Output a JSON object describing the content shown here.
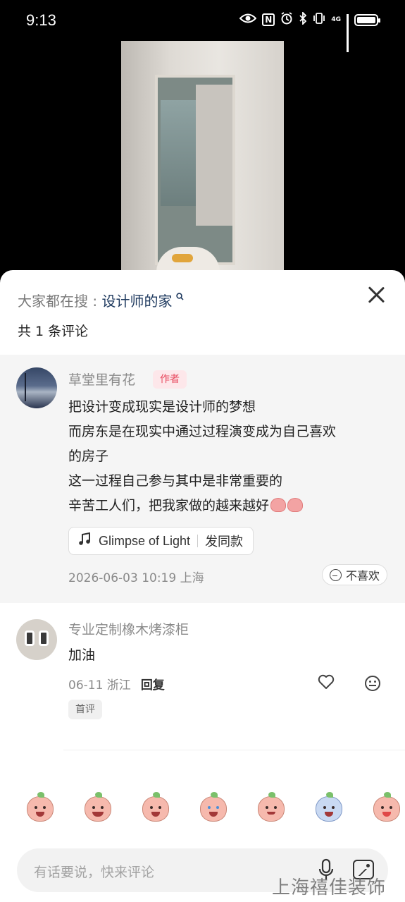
{
  "status_bar": {
    "time": "9:13",
    "nfc": "N",
    "network": "4G"
  },
  "sheet": {
    "search_prefix": "大家都在搜 : ",
    "search_keyword": "设计师的家",
    "comment_count": "共 1 条评论"
  },
  "author_comment": {
    "username": "草堂里有花",
    "tag": "作者",
    "lines": [
      "把设计变成现实是设计师的梦想",
      "而房东是在现实中通过过程演变成为自己喜欢",
      "的房子",
      "这一过程自己参与其中是非常重要的",
      "辛苦工人们，把我家做的越来越好"
    ],
    "music_title": "Glimpse of Light",
    "music_action": "发同款",
    "meta": "2026-06-03 10:19 上海",
    "dislike_label": "不喜欢"
  },
  "comment2": {
    "username": "专业定制橡木烤漆柜",
    "text": "加油",
    "meta": "06-11 浙江",
    "reply_label": "回复",
    "badge": "首评"
  },
  "input": {
    "placeholder": "有话要说，快来评论"
  },
  "watermark": "上海禧佳装饰",
  "colors": {
    "sheet_bg": "#ffffff",
    "author_block_bg": "#f5f5f5",
    "author_tag_bg": "#fde7ea",
    "author_tag_text": "#e84a5f",
    "keyword": "#1f3a5f"
  },
  "icons": [
    "eye-icon",
    "nfc-icon",
    "alarm-icon",
    "bluetooth-icon",
    "vibrate-icon",
    "signal-icon",
    "battery-icon",
    "search-icon",
    "close-icon",
    "music-note-icon",
    "dislike-icon",
    "like-icon",
    "mic-icon",
    "image-icon"
  ]
}
